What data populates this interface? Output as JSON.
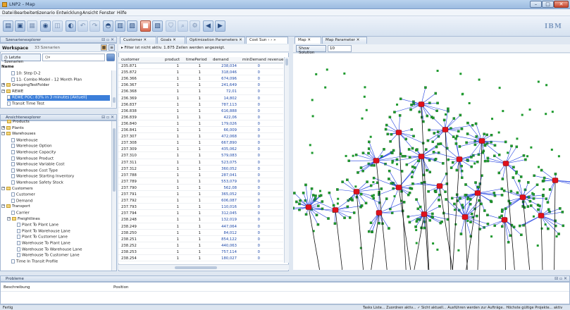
{
  "window": {
    "title": "LNP2 - Map",
    "min_label": "–",
    "max_label": "□",
    "close_label": "✕"
  },
  "menu": [
    "Datei",
    "Bearbeiten",
    "Szenario",
    "Entwicklung",
    "Ansicht",
    "Fenster",
    "Hilfe"
  ],
  "brand": "IBM",
  "scenario_explorer": {
    "title": "Szenarienexplorer",
    "controls": "⊟ ▫ ✕",
    "workspace_label": "Workspace",
    "workspace_count": "33 Szenarien",
    "search_tab": "Letzte Szenarien",
    "search_placeholder": "Q▾",
    "tree_header": "Name",
    "items": [
      {
        "label": "10: Step D-2",
        "indent": 14,
        "kind": "doc"
      },
      {
        "label": "11: Combo Model - 12 Month Plan",
        "indent": 14,
        "kind": "doc"
      },
      {
        "label": "GroupingTestFolder",
        "indent": 0,
        "kind": "folder",
        "toggle": "+"
      },
      {
        "label": "REWE",
        "indent": 0,
        "kind": "folder",
        "toggle": "−"
      },
      {
        "label": "REWE POC: 83% in 3 minutes [Aktuell]",
        "indent": 8,
        "kind": "doc",
        "selected": true
      },
      {
        "label": "Transit Time Test",
        "indent": 8,
        "kind": "doc"
      }
    ]
  },
  "view_explorer": {
    "title": "Ansichtenexplorer",
    "controls": "⊟ ▫ ✕",
    "items": [
      {
        "label": "Products",
        "indent": 8,
        "kind": "folder"
      },
      {
        "label": "Plants",
        "indent": 0,
        "kind": "folder",
        "toggle": "+"
      },
      {
        "label": "Warehouses",
        "indent": 0,
        "kind": "folder",
        "toggle": "−"
      },
      {
        "label": "Warehouse",
        "indent": 14,
        "kind": "doc"
      },
      {
        "label": "Warehouse Option",
        "indent": 14,
        "kind": "doc"
      },
      {
        "label": "Warehouse Capacity",
        "indent": 14,
        "kind": "doc"
      },
      {
        "label": "Warehouse Product",
        "indent": 14,
        "kind": "doc"
      },
      {
        "label": "Warehouse Variable Cost",
        "indent": 14,
        "kind": "doc"
      },
      {
        "label": "Warehouse Cost Type",
        "indent": 14,
        "kind": "doc"
      },
      {
        "label": "Warehouse Starting Inventory",
        "indent": 14,
        "kind": "doc"
      },
      {
        "label": "Warehouse Safety Stock",
        "indent": 14,
        "kind": "doc"
      },
      {
        "label": "Customers",
        "indent": 0,
        "kind": "folder",
        "toggle": "−"
      },
      {
        "label": "Customer",
        "indent": 14,
        "kind": "doc"
      },
      {
        "label": "Demand",
        "indent": 14,
        "kind": "doc"
      },
      {
        "label": "Transport",
        "indent": 0,
        "kind": "folder",
        "toggle": "−"
      },
      {
        "label": "Carrier",
        "indent": 14,
        "kind": "doc"
      },
      {
        "label": "Freightlines",
        "indent": 8,
        "kind": "folder",
        "toggle": "−"
      },
      {
        "label": "Plant To Plant Lane",
        "indent": 22,
        "kind": "doc"
      },
      {
        "label": "Plant To Warehouse Lane",
        "indent": 22,
        "kind": "doc"
      },
      {
        "label": "Plant To Customer Lane",
        "indent": 22,
        "kind": "doc"
      },
      {
        "label": "Warehouse To Plant Lane",
        "indent": 22,
        "kind": "doc"
      },
      {
        "label": "Warehouse To Warehouse Lane",
        "indent": 22,
        "kind": "doc"
      },
      {
        "label": "Warehouse To Customer Lane",
        "indent": 22,
        "kind": "doc"
      },
      {
        "label": "Time In Transit Profile",
        "indent": 14,
        "kind": "doc"
      }
    ]
  },
  "editor_tabs": [
    {
      "label": "Customer ✕"
    },
    {
      "label": "Goals ✕"
    },
    {
      "label": "Optimization Parameters ✕"
    },
    {
      "label": "Cost Sun ‹ › »"
    }
  ],
  "map_tabs": [
    {
      "label": "Map ✕",
      "active": true
    },
    {
      "label": "Map Parameter ✕"
    }
  ],
  "filter_text": "Filter ist nicht aktiv.  1.875 Zeilen werden angezeigt.",
  "grid": {
    "columns": [
      "customer",
      "product",
      "timePeriod",
      "demand",
      "minDemand",
      "revenue"
    ],
    "rows": [
      [
        "235.871",
        "1",
        "1",
        "238,034",
        "0"
      ],
      [
        "235.872",
        "1",
        "1",
        "318,046",
        "0"
      ],
      [
        "236.366",
        "1",
        "1",
        "674,096",
        "0"
      ],
      [
        "236.367",
        "1",
        "1",
        "241,649",
        "0"
      ],
      [
        "236.368",
        "1",
        "1",
        "72,01",
        "0"
      ],
      [
        "236.369",
        "1",
        "1",
        "14,802",
        "0"
      ],
      [
        "236.837",
        "1",
        "1",
        "787,113",
        "0"
      ],
      [
        "236.838",
        "1",
        "1",
        "616,888",
        "0"
      ],
      [
        "236.839",
        "1",
        "1",
        "422,06",
        "0"
      ],
      [
        "236.840",
        "1",
        "1",
        "179,026",
        "0"
      ],
      [
        "236.841",
        "1",
        "1",
        "66,009",
        "0"
      ],
      [
        "237.307",
        "1",
        "1",
        "472,068",
        "0"
      ],
      [
        "237.308",
        "1",
        "1",
        "667,890",
        "0"
      ],
      [
        "237.309",
        "1",
        "1",
        "435,062",
        "0"
      ],
      [
        "237.310",
        "1",
        "1",
        "579,083",
        "0"
      ],
      [
        "237.311",
        "1",
        "1",
        "523,075",
        "0"
      ],
      [
        "237.312",
        "1",
        "1",
        "360,052",
        "0"
      ],
      [
        "237.788",
        "1",
        "1",
        "287,041",
        "0"
      ],
      [
        "237.789",
        "1",
        "1",
        "553,079",
        "0"
      ],
      [
        "237.790",
        "1",
        "1",
        "562,08",
        "0"
      ],
      [
        "237.791",
        "1",
        "1",
        "365,052",
        "0"
      ],
      [
        "237.792",
        "1",
        "1",
        "606,087",
        "0"
      ],
      [
        "237.793",
        "1",
        "1",
        "110,016",
        "0"
      ],
      [
        "237.794",
        "1",
        "1",
        "312,045",
        "0"
      ],
      [
        "238.248",
        "1",
        "1",
        "132,019",
        "0"
      ],
      [
        "238.249",
        "1",
        "1",
        "447,064",
        "0"
      ],
      [
        "238.250",
        "1",
        "1",
        "84,012",
        "0"
      ],
      [
        "238.251",
        "1",
        "1",
        "854,122",
        "0"
      ],
      [
        "238.252",
        "1",
        "1",
        "440,063",
        "0"
      ],
      [
        "238.253",
        "1",
        "1",
        "757,114",
        "0"
      ],
      [
        "238.254",
        "1",
        "1",
        "180,027",
        "0"
      ]
    ]
  },
  "map": {
    "show_solution_label": "Show Solution",
    "zoom_value": "10",
    "colors": {
      "customer": "#1e9a2e",
      "warehouse": "#e0101b",
      "lane": "#1f3fe0",
      "inbound": "#111111"
    }
  },
  "probleme": {
    "title": "Probleme",
    "col1": "Beschreibung",
    "col2": "Position",
    "controls": "⊟ ▫ ✕"
  },
  "status": {
    "left": "Fertig",
    "right": "Tasks Liste... Zuordnen aktiv... ✓ Sicht aktuell... Ausführen werden zur Aufträge.. Höchste gültige Projekte... aktiv"
  }
}
